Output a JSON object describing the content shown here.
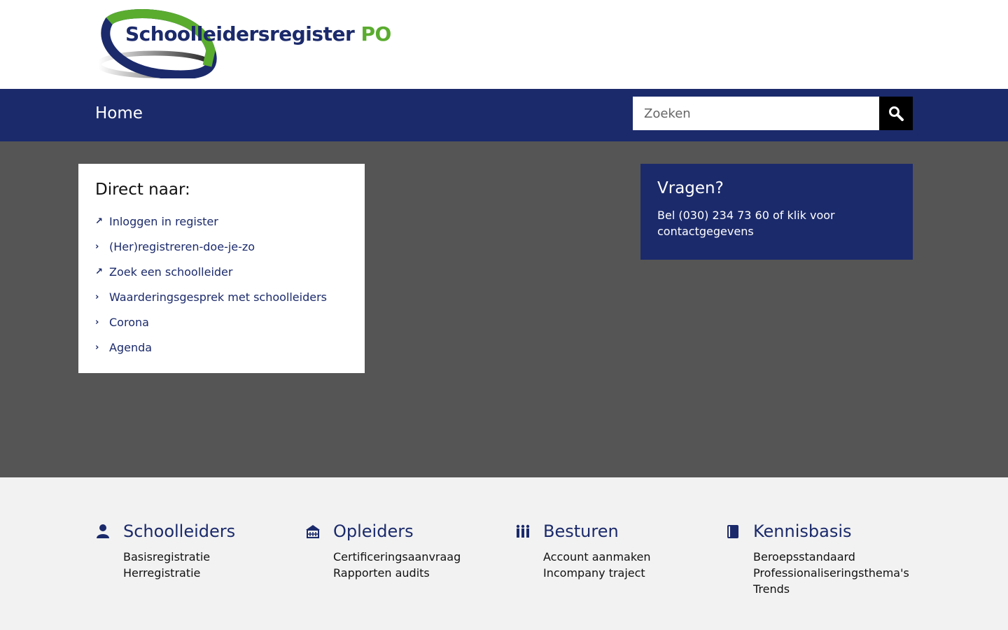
{
  "logo": {
    "text": "Schoolleidersregister",
    "suffix": "PO"
  },
  "nav": {
    "home": "Home",
    "search_placeholder": "Zoeken"
  },
  "direct": {
    "title": "Direct naar:",
    "items": [
      {
        "label": "Inloggen in register",
        "icon": "external-arrow"
      },
      {
        "label": "(Her)registreren-doe-je-zo",
        "icon": "chevron-right"
      },
      {
        "label": "Zoek een schoolleider",
        "icon": "external-arrow"
      },
      {
        "label": "Waarderingsgesprek met schoolleiders",
        "icon": "chevron-right"
      },
      {
        "label": "Corona",
        "icon": "chevron-right"
      },
      {
        "label": "Agenda",
        "icon": "chevron-right"
      }
    ]
  },
  "vragen": {
    "title": "Vragen?",
    "text": "Bel (030) 234 73 60 of klik voor contactgegevens"
  },
  "footer": [
    {
      "title": "Schoolleiders",
      "icon": "person",
      "links": [
        "Basisregistratie",
        "Herregistratie"
      ]
    },
    {
      "title": "Opleiders",
      "icon": "school",
      "links": [
        "Certificeringsaanvraag",
        "Rapporten audits"
      ]
    },
    {
      "title": "Besturen",
      "icon": "group",
      "links": [
        "Account aanmaken",
        "Incompany traject"
      ]
    },
    {
      "title": "Kennisbasis",
      "icon": "book",
      "links": [
        "Beroepsstandaard",
        "Professionaliseringsthema's",
        "Trends"
      ]
    }
  ],
  "colors": {
    "navy": "#1b2a6b",
    "green": "#5aac2f",
    "grey": "#555555"
  }
}
